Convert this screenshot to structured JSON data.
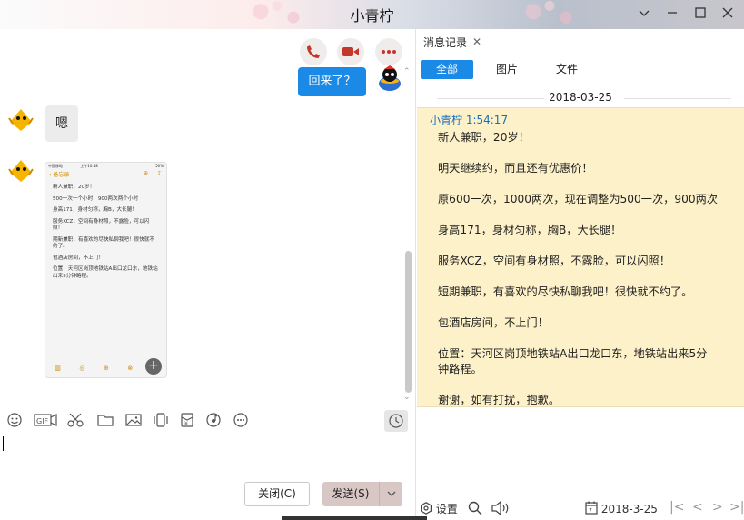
{
  "window": {
    "title": "小青柠"
  },
  "chat": {
    "messages": {
      "me_text": "回来了？",
      "other_text": "嗯"
    },
    "image": {
      "status_left": "中国移动",
      "status_time": "上午10:48",
      "status_right": "50%",
      "back_label": "备忘录",
      "lines": [
        "新人兼职，20岁！",
        "500一次一个小时，900两次两个小时",
        "身高171，身材匀称，胸B，大长腿！",
        "服务XCZ，空间有身材照，不露脸，可以闪照！",
        "期新兼职，有喜欢的尽快私聊我吧！很快就不约了。",
        "包酒店房间，不上门！",
        "位置：天河区岗顶地铁站A出口龙口东，地铁站出来5分钟路程。"
      ]
    },
    "buttons": {
      "close": "关闭(C)",
      "send": "发送(S)"
    }
  },
  "history": {
    "tab": "消息记录",
    "filters": [
      "全部",
      "图片",
      "文件"
    ],
    "date": "2018-03-25",
    "sender": "小青柠 1:54:17",
    "lines": [
      "新人兼职，20岁！",
      "明天继续约，而且还有优惠价！",
      "原600一次，1000两次，现在调整为500一次，900两次",
      "身高171，身材匀称，胸B，大长腿！",
      "服务XCZ，空间有身材照，不露脸，可以闪照！",
      "短期兼职，有喜欢的尽快私聊我吧！很快就不约了。",
      "包酒店房间，不上门！",
      "位置：天河区岗顶地铁站A出口龙口东，地铁站出来5分钟路程。",
      "谢谢，如有打扰，抱歉。"
    ],
    "footer": {
      "settings": "设置",
      "date": "2018-3-25"
    }
  },
  "colors": {
    "accent": "#1a8ae6",
    "history_bg": "#fdf1c9",
    "send_bg": "#d9c7c6"
  }
}
